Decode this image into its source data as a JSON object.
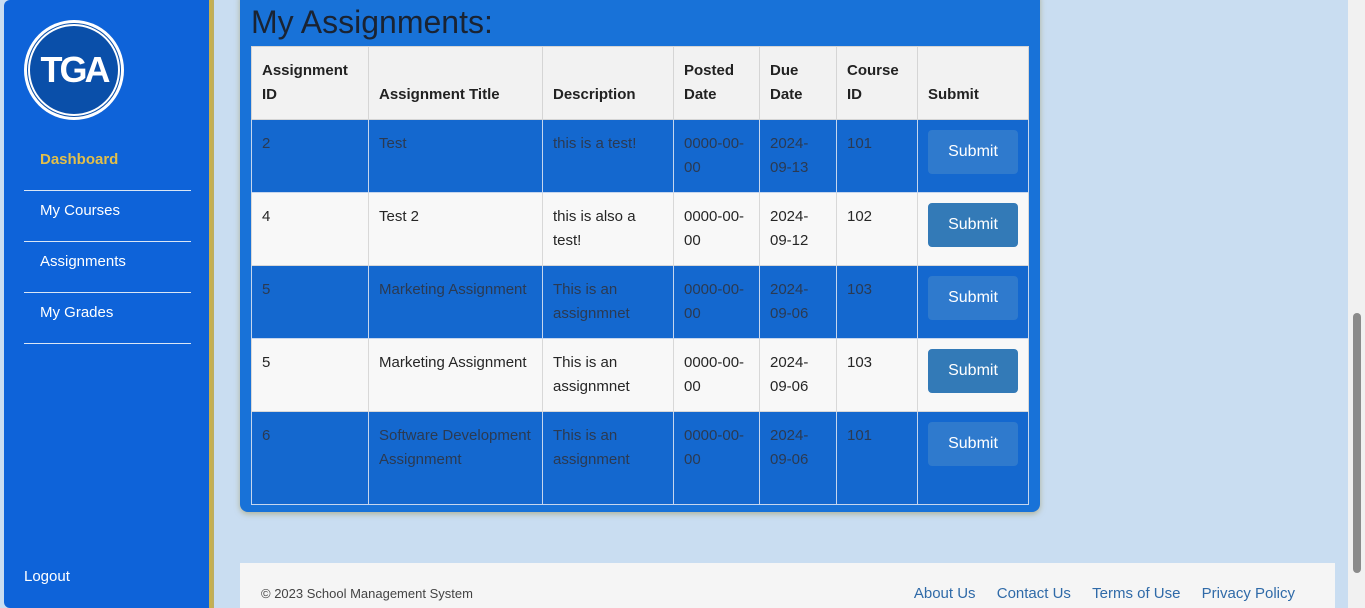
{
  "sidebar": {
    "logo_text": "TGA",
    "items": [
      {
        "label": "Dashboard",
        "active": true
      },
      {
        "label": "My Courses",
        "active": false
      },
      {
        "label": "Assignments",
        "active": false
      },
      {
        "label": "My Grades",
        "active": false
      }
    ],
    "logout": "Logout"
  },
  "main": {
    "title": "My Assignments:",
    "table": {
      "headers": [
        "Assignment ID",
        "Assignment Title",
        "Description",
        "Posted Date",
        "Due Date",
        "Course ID",
        "Submit"
      ],
      "rows": [
        {
          "id": "2",
          "title": "Test",
          "description": "this is a test!",
          "posted": "0000-00-00",
          "due": "2024-09-13",
          "course": "101",
          "action": "Submit"
        },
        {
          "id": "4",
          "title": "Test 2",
          "description": "this is also a test!",
          "posted": "0000-00-00",
          "due": "2024-09-12",
          "course": "102",
          "action": "Submit"
        },
        {
          "id": "5",
          "title": "Marketing Assignment",
          "description": "This is an assignmnet",
          "posted": "0000-00-00",
          "due": "2024-09-06",
          "course": "103",
          "action": "Submit"
        },
        {
          "id": "5",
          "title": "Marketing Assignment",
          "description": "This is an assignmnet",
          "posted": "0000-00-00",
          "due": "2024-09-06",
          "course": "103",
          "action": "Submit"
        },
        {
          "id": "6",
          "title": "Software Development Assignmemt",
          "description": "This is an assignment",
          "posted": "0000-00-00",
          "due": "2024-09-06",
          "course": "101",
          "action": "Submit"
        }
      ]
    }
  },
  "footer": {
    "copyright": "© 2023 School Management System",
    "links": [
      "About Us",
      "Contact Us",
      "Terms of Use",
      "Privacy Policy"
    ]
  }
}
